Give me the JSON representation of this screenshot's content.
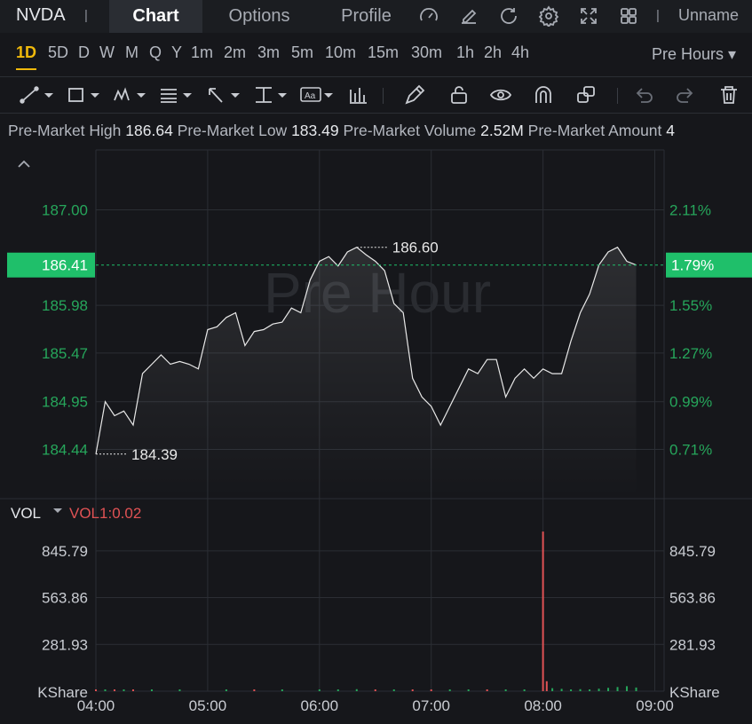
{
  "header": {
    "symbol": "NVDA",
    "separator": "|",
    "tabs": [
      {
        "label": "Chart",
        "active": true
      },
      {
        "label": "Options",
        "active": false
      },
      {
        "label": "Profile",
        "active": false
      }
    ],
    "icons": [
      "gauge-icon",
      "edit-icon",
      "refresh-icon",
      "settings-icon",
      "fullscreen-icon",
      "grid-icon"
    ],
    "username": "Unname"
  },
  "periods": {
    "items": [
      "1D",
      "5D",
      "D",
      "W",
      "M",
      "Q",
      "Y",
      "1m",
      "2m",
      "3m",
      "5m",
      "10m",
      "15m",
      "30m",
      "1h",
      "2h",
      "4h"
    ],
    "active": "1D",
    "session_selector": "Pre Hours ▾"
  },
  "tools": [
    "trend-line-icon",
    "rectangle-icon",
    "pattern-icon",
    "fib-icon",
    "arrow-icon",
    "measure-icon",
    "text-icon",
    "indicator-icon",
    "pencil-icon",
    "lock-icon",
    "eye-icon",
    "magnet-icon",
    "layers-icon",
    "undo-icon",
    "redo-icon",
    "trash-icon"
  ],
  "info_bar": [
    {
      "label": "Pre-Market High",
      "value": "186.64"
    },
    {
      "label": "Pre-Market Low",
      "value": "183.49"
    },
    {
      "label": "Pre-Market Volume",
      "value": "2.52M"
    },
    {
      "label": "Pre-Market Amount",
      "value": "4"
    }
  ],
  "colors": {
    "up": "#26a65b",
    "down": "#e05254",
    "accent": "#f0b90b",
    "price_badge": "#1fbf6a",
    "line": "#e8e8e8"
  },
  "chart_data": {
    "type": "line",
    "watermark": "Pre Hour",
    "x_ticks": [
      "04:00",
      "05:00",
      "06:00",
      "07:00",
      "08:00",
      "09:00"
    ],
    "price_ticks": [
      "187.00",
      "185.98",
      "185.47",
      "184.95",
      "184.44"
    ],
    "percent_ticks": [
      "2.11%",
      "1.55%",
      "1.27%",
      "0.99%",
      "0.71%"
    ],
    "current_price": "186.41",
    "current_percent": "1.79%",
    "high_label": "186.60",
    "low_label": "184.39",
    "ylim": [
      184.2,
      187.4
    ],
    "series": [
      {
        "x": [
          "04:00",
          "04:05",
          "04:10",
          "04:15",
          "04:20",
          "04:25",
          "04:30",
          "04:35",
          "04:40",
          "04:45",
          "04:50",
          "04:55",
          "05:00",
          "05:05",
          "05:10",
          "05:15",
          "05:20",
          "05:25",
          "05:30",
          "05:35",
          "05:40",
          "05:45",
          "05:50",
          "05:55",
          "06:00",
          "06:05",
          "06:10",
          "06:15",
          "06:20",
          "06:25",
          "06:30",
          "06:35",
          "06:40",
          "06:45",
          "06:50",
          "06:55",
          "07:00",
          "07:05",
          "07:10",
          "07:15",
          "07:20",
          "07:25",
          "07:30",
          "07:35",
          "07:40",
          "07:45",
          "07:50",
          "07:55",
          "08:00",
          "08:05",
          "08:10",
          "08:15",
          "08:20",
          "08:25",
          "08:30",
          "08:35",
          "08:40",
          "08:45",
          "08:50"
        ],
        "values": [
          184.39,
          184.95,
          184.8,
          184.85,
          184.7,
          185.25,
          185.35,
          185.45,
          185.35,
          185.38,
          185.35,
          185.3,
          185.72,
          185.75,
          185.85,
          185.9,
          185.55,
          185.7,
          185.72,
          185.78,
          185.8,
          185.95,
          185.9,
          186.25,
          186.45,
          186.5,
          186.4,
          186.55,
          186.6,
          186.52,
          186.45,
          186.35,
          186.0,
          185.9,
          185.2,
          185.0,
          184.9,
          184.7,
          184.9,
          185.1,
          185.3,
          185.25,
          185.4,
          185.4,
          185.0,
          185.2,
          185.3,
          185.2,
          185.3,
          185.25,
          185.25,
          185.6,
          185.9,
          186.1,
          186.41,
          186.55,
          186.6,
          186.45,
          186.41
        ]
      }
    ],
    "volume": {
      "label": "VOL",
      "indicator": "VOL1:0.02",
      "ticks": [
        "845.79",
        "563.86",
        "281.93"
      ],
      "unit_label": "KShare",
      "ylim": [
        0,
        1000
      ],
      "spike": {
        "x": "08:00",
        "value": 962
      },
      "bars": [
        {
          "x": "04:00",
          "value": 8,
          "dir": "down"
        },
        {
          "x": "04:05",
          "value": 5,
          "dir": "up"
        },
        {
          "x": "04:10",
          "value": 3,
          "dir": "down"
        },
        {
          "x": "04:15",
          "value": 4,
          "dir": "up"
        },
        {
          "x": "04:20",
          "value": 6,
          "dir": "down"
        },
        {
          "x": "04:30",
          "value": 4,
          "dir": "up"
        },
        {
          "x": "04:45",
          "value": 3,
          "dir": "up"
        },
        {
          "x": "05:10",
          "value": 5,
          "dir": "up"
        },
        {
          "x": "05:25",
          "value": 4,
          "dir": "down"
        },
        {
          "x": "05:40",
          "value": 3,
          "dir": "up"
        },
        {
          "x": "06:00",
          "value": 10,
          "dir": "up"
        },
        {
          "x": "06:10",
          "value": 8,
          "dir": "up"
        },
        {
          "x": "06:20",
          "value": 12,
          "dir": "up"
        },
        {
          "x": "06:30",
          "value": 9,
          "dir": "down"
        },
        {
          "x": "06:40",
          "value": 7,
          "dir": "up"
        },
        {
          "x": "06:50",
          "value": 10,
          "dir": "down"
        },
        {
          "x": "07:00",
          "value": 6,
          "dir": "down"
        },
        {
          "x": "07:10",
          "value": 5,
          "dir": "up"
        },
        {
          "x": "07:20",
          "value": 9,
          "dir": "up"
        },
        {
          "x": "07:30",
          "value": 7,
          "dir": "down"
        },
        {
          "x": "07:40",
          "value": 6,
          "dir": "up"
        },
        {
          "x": "07:50",
          "value": 5,
          "dir": "up"
        },
        {
          "x": "08:00",
          "value": 962,
          "dir": "down"
        },
        {
          "x": "08:02",
          "value": 60,
          "dir": "down"
        },
        {
          "x": "08:05",
          "value": 18,
          "dir": "up"
        },
        {
          "x": "08:10",
          "value": 14,
          "dir": "up"
        },
        {
          "x": "08:15",
          "value": 10,
          "dir": "up"
        },
        {
          "x": "08:20",
          "value": 12,
          "dir": "up"
        },
        {
          "x": "08:25",
          "value": 9,
          "dir": "up"
        },
        {
          "x": "08:30",
          "value": 15,
          "dir": "up"
        },
        {
          "x": "08:35",
          "value": 20,
          "dir": "up"
        },
        {
          "x": "08:40",
          "value": 25,
          "dir": "up"
        },
        {
          "x": "08:45",
          "value": 30,
          "dir": "up"
        },
        {
          "x": "08:50",
          "value": 22,
          "dir": "up"
        }
      ]
    }
  }
}
